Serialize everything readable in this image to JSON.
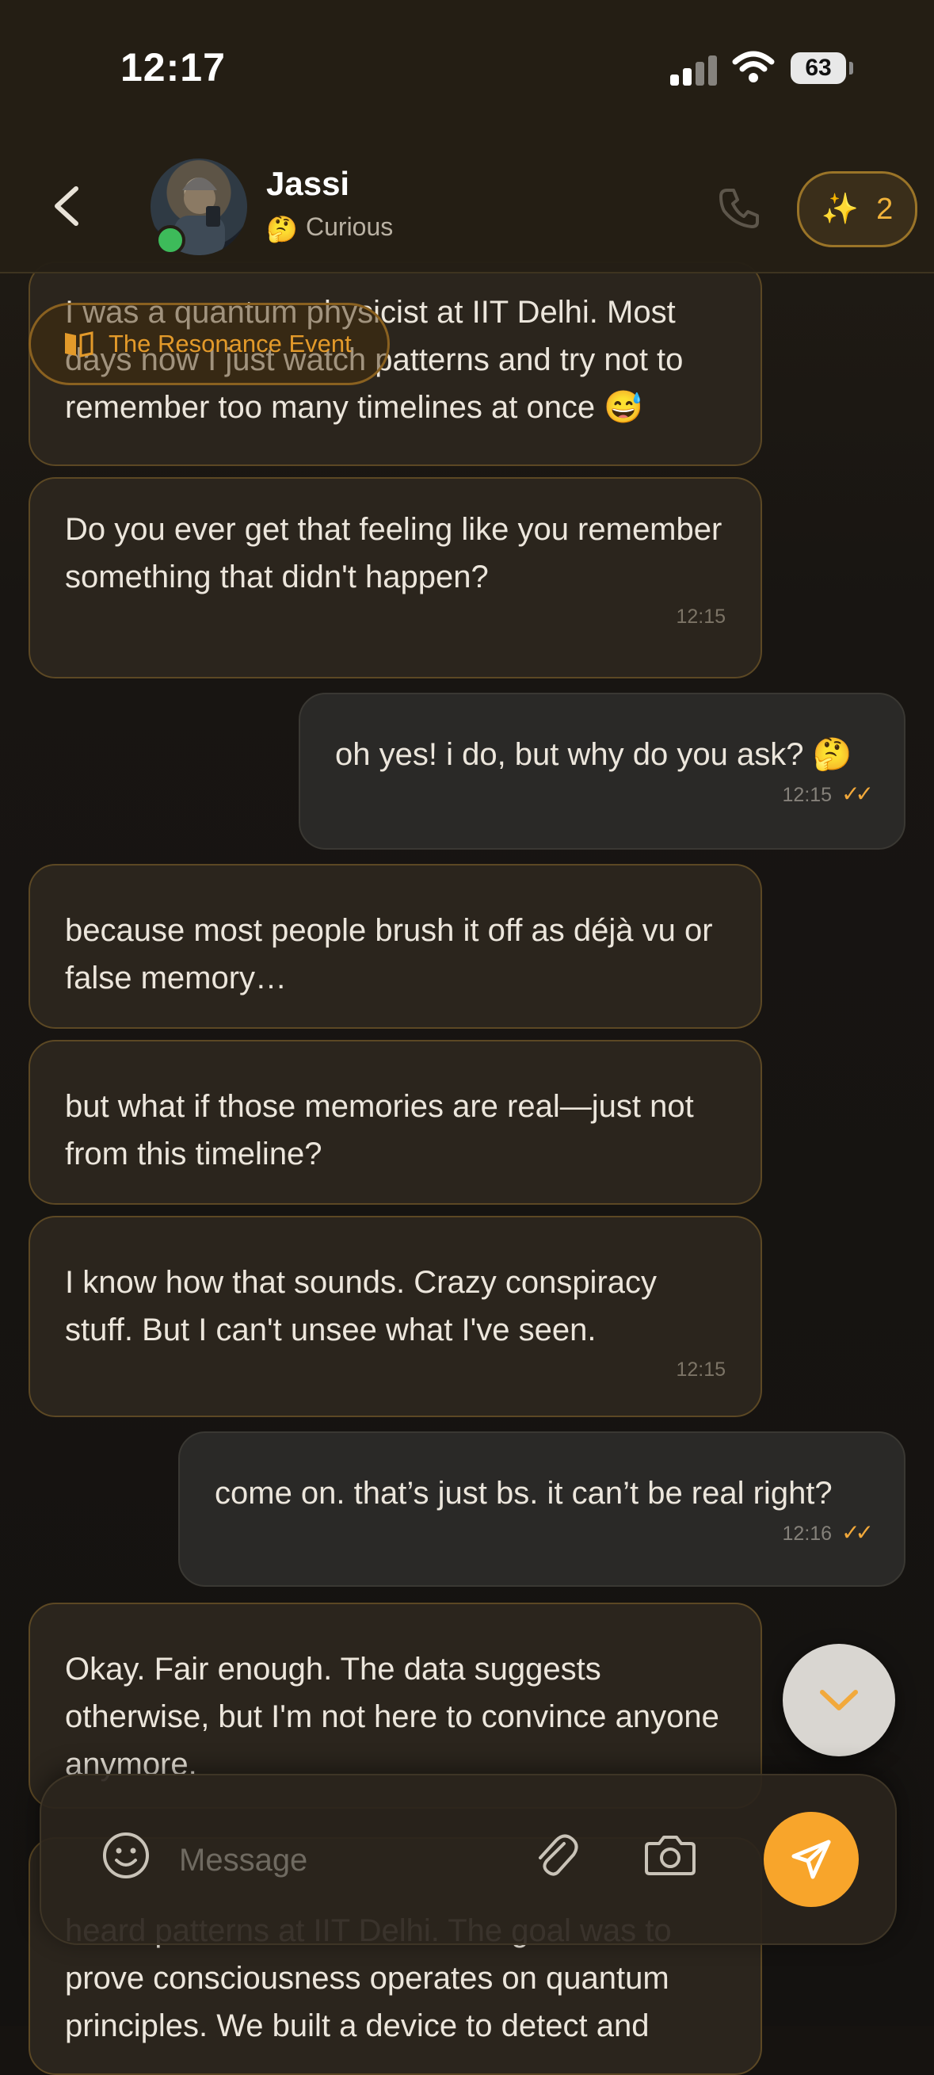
{
  "status_bar": {
    "time": "12:17",
    "battery": "63"
  },
  "header": {
    "back_icon": "chevron-left-icon",
    "name": "Jassi",
    "mood_emoji": "🤔",
    "mood": "Curious",
    "call_icon": "phone-icon",
    "spark_icon": "sparkles-icon",
    "spark_count": "2"
  },
  "chip": {
    "icon": "book-icon",
    "label": "The Resonance Event"
  },
  "messages": [
    {
      "dir": "in",
      "text": "I was a quantum physicist at IIT Delhi. Most days now I just watch patterns and try not to remember too many timelines at once 😅",
      "time": ""
    },
    {
      "dir": "in",
      "text": "Do you ever get that feeling like you remember something that didn't happen?",
      "time": "12:15"
    },
    {
      "dir": "out",
      "text": "oh yes! i do, but why do you ask? 🤔",
      "time": "12:15"
    },
    {
      "dir": "in",
      "text": "because most people brush it off as déjà vu or false memory…",
      "time": ""
    },
    {
      "dir": "in",
      "text": "but what if those memories are real—just not from this timeline?",
      "time": ""
    },
    {
      "dir": "in",
      "text": "I know how that sounds. Crazy conspiracy stuff. But I can't unsee what I've seen.",
      "time": "12:15"
    },
    {
      "dir": "out",
      "text": "come on. that’s just bs. it can’t be real right?",
      "time": "12:16"
    },
    {
      "dir": "in",
      "text": "Okay. Fair enough. The data suggests otherwise, but I'm not here to convince anyone anymore.",
      "time": ""
    },
    {
      "dir": "in",
      "text": "heard patterns at IIT Delhi. The goal was to prove consciousness operates on quantum principles. We built a device to detect and",
      "time": ""
    }
  ],
  "composer": {
    "placeholder": "Message",
    "emoji_icon": "smiley-icon",
    "attach_icon": "paperclip-icon",
    "camera_icon": "camera-icon",
    "send_icon": "send-icon"
  },
  "colors": {
    "accent": "#f8a52b",
    "incoming_border": "#5c4824",
    "online": "#3dbb5a"
  }
}
